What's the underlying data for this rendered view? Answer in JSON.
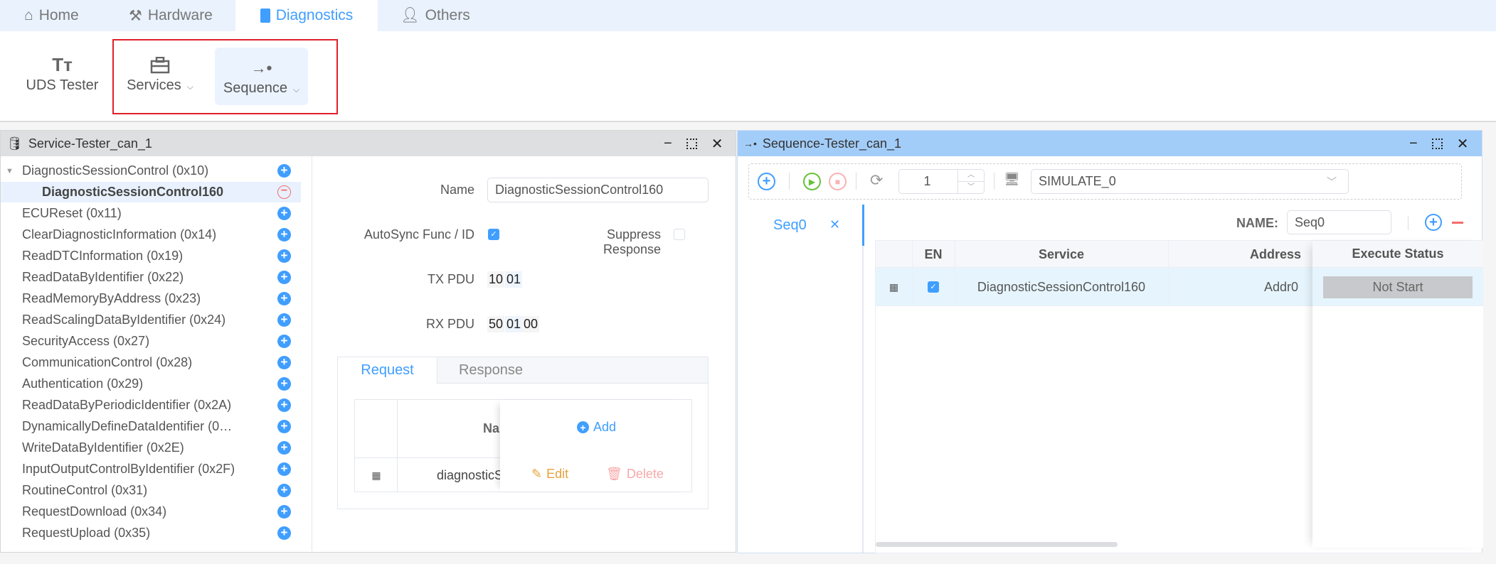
{
  "top_tabs": [
    {
      "label": "Home",
      "icon": "home-icon"
    },
    {
      "label": "Hardware",
      "icon": "hammer-icon"
    },
    {
      "label": "Diagnostics",
      "icon": "diagnostics-icon",
      "active": true
    },
    {
      "label": "Others",
      "icon": "user-icon"
    }
  ],
  "ribbon": {
    "uds_tester": "UDS Tester",
    "services": "Services",
    "sequence": "Sequence"
  },
  "service_panel": {
    "title": "Service-Tester_can_1",
    "tree": [
      {
        "label": "DiagnosticSessionControl (0x10)",
        "expanded": true
      },
      {
        "label": "DiagnosticSessionControl160",
        "child": true,
        "selected": true
      },
      {
        "label": "ECUReset (0x11)"
      },
      {
        "label": "ClearDiagnosticInformation (0x14)"
      },
      {
        "label": "ReadDTCInformation (0x19)"
      },
      {
        "label": "ReadDataByIdentifier (0x22)"
      },
      {
        "label": "ReadMemoryByAddress (0x23)"
      },
      {
        "label": "ReadScalingDataByIdentifier (0x24)"
      },
      {
        "label": "SecurityAccess (0x27)"
      },
      {
        "label": "CommunicationControl (0x28)"
      },
      {
        "label": "Authentication (0x29)"
      },
      {
        "label": "ReadDataByPeriodicIdentifier (0x2A)"
      },
      {
        "label": "DynamicallyDefineDataIdentifier (0…"
      },
      {
        "label": "WriteDataByIdentifier (0x2E)"
      },
      {
        "label": "InputOutputControlByIdentifier (0x2F)"
      },
      {
        "label": "RoutineControl (0x31)"
      },
      {
        "label": "RequestDownload (0x34)"
      },
      {
        "label": "RequestUpload (0x35)"
      }
    ],
    "form": {
      "name_label": "Name",
      "name_value": "DiagnosticSessionControl160",
      "autosync_label": "AutoSync Func / ID",
      "autosync_checked": true,
      "suppress_label": "Suppress Response",
      "suppress_checked": false,
      "tx_label": "TX PDU",
      "tx_bytes": [
        "10",
        "01"
      ],
      "rx_label": "RX PDU",
      "rx_bytes": [
        "50",
        "01",
        "00"
      ]
    },
    "tabs": {
      "request": "Request",
      "response": "Response"
    },
    "param_table": {
      "header_name": "Na",
      "add": "Add",
      "row_name": "diagnosticS",
      "edit": "Edit",
      "delete": "Delete"
    }
  },
  "sequence_panel": {
    "title": "Sequence-Tester_can_1",
    "repeat": "1",
    "device": "SIMULATE_0",
    "seq_tab": "Seq0",
    "name_label": "NAME:",
    "name_value": "Seq0",
    "columns": [
      "EN",
      "Service",
      "Address",
      "Execute Status"
    ],
    "rows": [
      {
        "enabled": true,
        "service": "DiagnosticSessionControl160",
        "address": "Addr0",
        "status": "Not Start"
      }
    ]
  },
  "colors": {
    "accent": "#409eff",
    "danger": "#f56c6c",
    "success": "#67c23a",
    "edit": "#e6a23c",
    "highlight": "#e0202a"
  }
}
